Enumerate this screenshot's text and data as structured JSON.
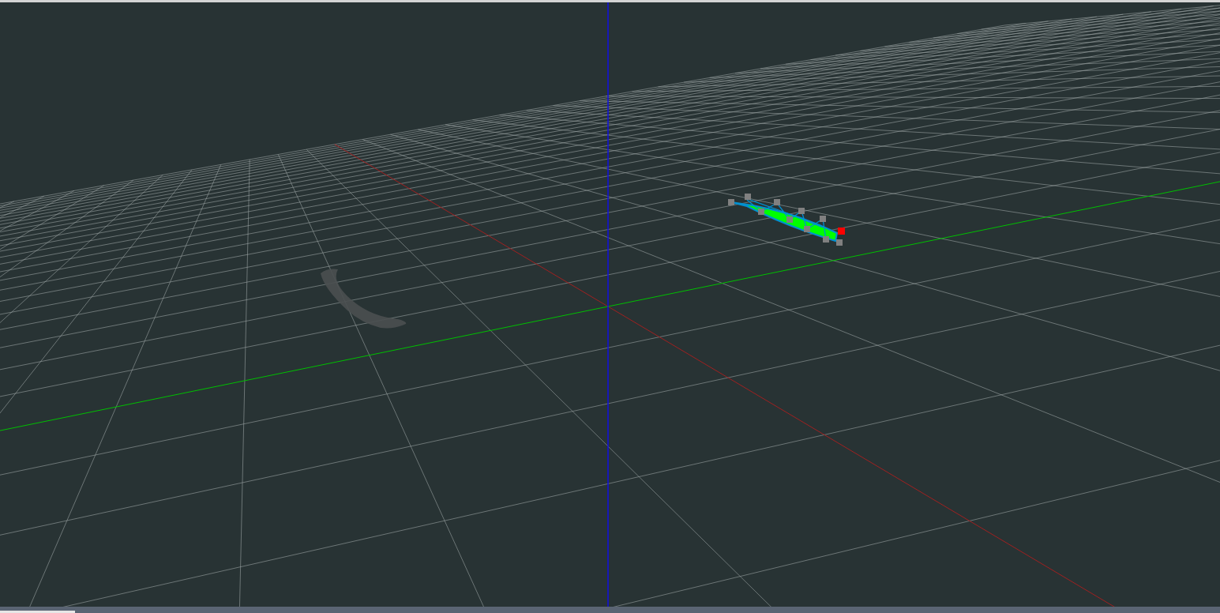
{
  "scene": {
    "objects": [
      {
        "kind": "curve-mesh",
        "selected": true
      },
      {
        "kind": "brush-stroke",
        "selected": false
      }
    ]
  }
}
